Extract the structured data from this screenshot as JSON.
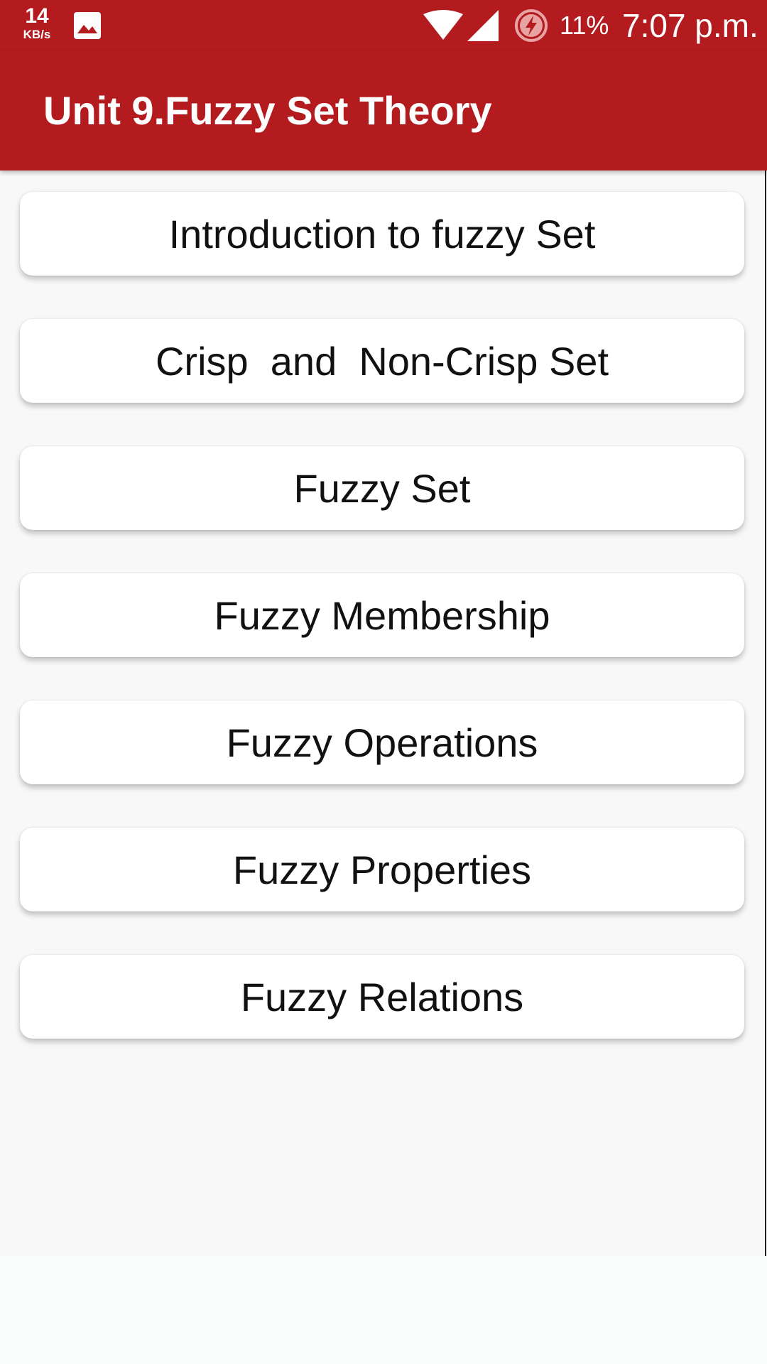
{
  "status_bar": {
    "net_speed_value": "14",
    "net_speed_unit": "KB/s",
    "icons": [
      "image-notification-icon",
      "wifi-icon",
      "cell-signal-icon",
      "battery-saver-icon"
    ],
    "battery": "11%",
    "time": "7:07 p.m."
  },
  "app_bar": {
    "title": "Unit 9.Fuzzy Set Theory"
  },
  "topics": [
    "Introduction to fuzzy Set",
    "Crisp  and  Non-Crisp Set",
    "Fuzzy Set",
    "Fuzzy Membership",
    "Fuzzy Operations",
    "Fuzzy Properties",
    "Fuzzy Relations"
  ],
  "colors": {
    "primary": "#b31b1e",
    "background": "#f8f8f8",
    "button": "#ffffff",
    "text": "#111111"
  }
}
